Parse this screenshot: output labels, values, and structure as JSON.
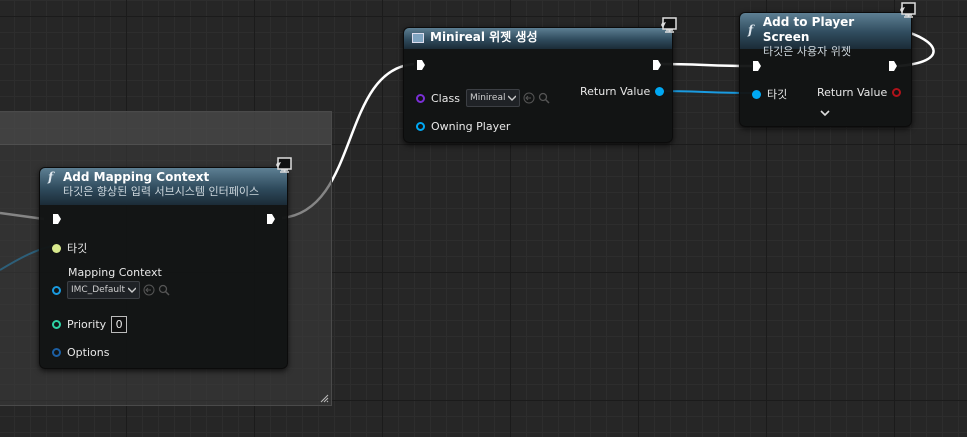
{
  "colors": {
    "exec_wire": "#ffffff",
    "object_wire": "#1a9be0",
    "object_pin": "#00a8f3",
    "class_pin": "#7a2fd6",
    "int_pin": "#2ed4a5",
    "struct_pin": "#1c5fa3",
    "target_pin": "#d8e98d",
    "return_red": "#b0121a"
  },
  "create_widget_node": {
    "title": "Minireal 위젯 생성",
    "class_label": "Class",
    "class_value": "Minireal",
    "owning_player_label": "Owning Player",
    "return_label": "Return Value"
  },
  "add_to_player_screen_node": {
    "title": "Add to Player Screen",
    "subtitle": "타깃은 사용자 위젯",
    "target_label": "타깃",
    "return_label": "Return Value"
  },
  "add_mapping_context_node": {
    "title": "Add Mapping Context",
    "subtitle": "타깃은 향상된 입력 서브시스템 인터페이스",
    "target_label": "타깃",
    "mapping_context_label": "Mapping Context",
    "mapping_context_value": "IMC_Default",
    "priority_label": "Priority",
    "priority_value": "0",
    "options_label": "Options"
  },
  "icons": {
    "function": "f-icon",
    "widget": "widget-icon",
    "context": "context-sensitive-icon",
    "browse": "browse-arrow-icon",
    "search": "search-icon",
    "expand": "chevron-down-icon"
  }
}
